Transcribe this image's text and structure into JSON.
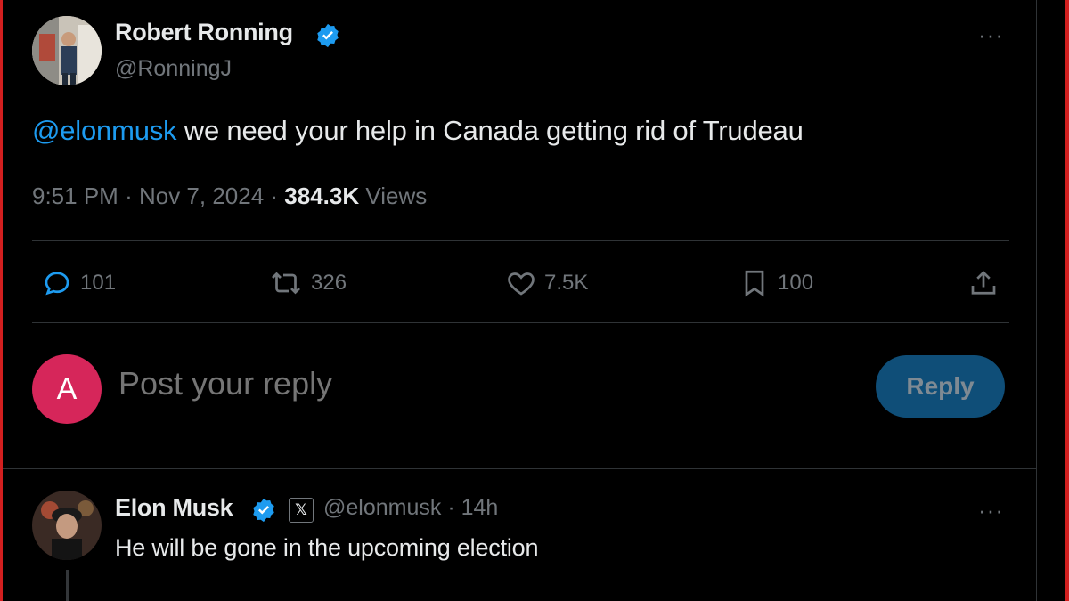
{
  "tweet": {
    "author_name": "Robert Ronning",
    "author_handle": "@RonningJ",
    "mention": "@elonmusk",
    "text": " we need your help in Canada getting rid of Trudeau",
    "time": "9:51 PM",
    "date": "Nov 7, 2024",
    "views_count": "384.3K",
    "views_label": "Views",
    "more_icon": "more-icon",
    "actions": {
      "replies": "101",
      "reposts": "326",
      "likes": "7.5K",
      "bookmarks": "100"
    }
  },
  "composer": {
    "avatar_letter": "A",
    "placeholder": "Post your reply",
    "button_label": "Reply"
  },
  "reply": {
    "author_name": "Elon Musk",
    "badge": "𝕏",
    "handle": "@elonmusk",
    "time": "14h",
    "text": "He will be gone in the upcoming election"
  },
  "colors": {
    "accent": "#1d9bf0",
    "background": "#000000",
    "muted": "#71767b",
    "reply_button": "#0f4e78",
    "avatar_bg": "#d6265a",
    "frame": "#d21f1f"
  }
}
